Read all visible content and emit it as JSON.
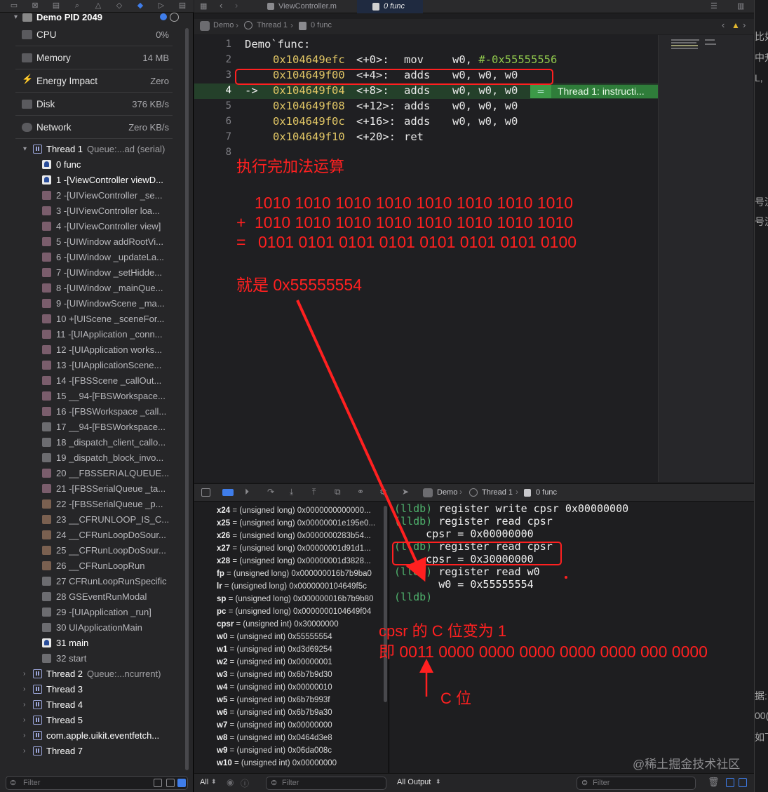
{
  "navigator": {
    "process": "Demo PID 2049",
    "gauges": [
      {
        "label": "CPU",
        "value": "0%"
      },
      {
        "label": "Memory",
        "value": "14 MB"
      },
      {
        "label": "Energy Impact",
        "value": "Zero"
      },
      {
        "label": "Disk",
        "value": "376 KB/s"
      },
      {
        "label": "Network",
        "value": "Zero KB/s"
      }
    ],
    "thread1": {
      "name": "Thread 1",
      "queue": "Queue:...ad (serial)"
    },
    "frames": [
      "0 func",
      "1 -[ViewController viewD...",
      "2 -[UIViewController _se...",
      "3 -[UIViewController loa...",
      "4 -[UIViewController view]",
      "5 -[UIWindow addRootVi...",
      "6 -[UIWindow _updateLa...",
      "7 -[UIWindow _setHidde...",
      "8 -[UIWindow _mainQue...",
      "9 -[UIWindowScene _ma...",
      "10 +[UIScene _sceneFor...",
      "11 -[UIApplication _conn...",
      "12 -[UIApplication works...",
      "13 -[UIApplicationScene...",
      "14 -[FBSScene _callOut...",
      "15 __94-[FBSWorkspace...",
      "16 -[FBSWorkspace _call...",
      "17 __94-[FBSWorkspace...",
      "18 _dispatch_client_callo...",
      "19 _dispatch_block_invo...",
      "20 __FBSSERIALQUEUE...",
      "21 -[FBSSerialQueue _ta...",
      "22 -[FBSSerialQueue _p...",
      "23 __CFRUNLOOP_IS_C...",
      "24 __CFRunLoopDoSour...",
      "25 __CFRunLoopDoSour...",
      "26 __CFRunLoopRun",
      "27 CFRunLoopRunSpecific",
      "28 GSEventRunModal",
      "29 -[UIApplication _run]",
      "30 UIApplicationMain",
      "31 main",
      "32 start"
    ],
    "threads": [
      {
        "name": "Thread 2",
        "queue": "Queue:...ncurrent)"
      },
      {
        "name": "Thread 3",
        "queue": ""
      },
      {
        "name": "Thread 4",
        "queue": ""
      },
      {
        "name": "Thread 5",
        "queue": ""
      },
      {
        "name": "com.apple.uikit.eventfetch...",
        "queue": ""
      },
      {
        "name": "Thread 7",
        "queue": ""
      }
    ],
    "filter_placeholder": "Filter"
  },
  "tabs": {
    "file": "ViewController.m",
    "active": "0 func"
  },
  "jumpbar": {
    "project": "Demo",
    "thread": "Thread 1",
    "frame": "0 func"
  },
  "editor": {
    "lines": [
      {
        "n": "1",
        "addr": "",
        "off": "",
        "op": "",
        "args": "",
        "text": "Demo`func:"
      },
      {
        "n": "2",
        "addr": "0x104649efc",
        "off": "<+0>:",
        "op": "mov",
        "args": "w0, ",
        "imm": "#-0x55555556"
      },
      {
        "n": "3",
        "addr": "0x104649f00",
        "off": "<+4>:",
        "op": "adds",
        "args": "w0, w0, w0"
      },
      {
        "n": "4",
        "addr": "0x104649f04",
        "off": "<+8>:",
        "op": "adds",
        "args": "w0, w0, w0"
      },
      {
        "n": "5",
        "addr": "0x104649f08",
        "off": "<+12>:",
        "op": "adds",
        "args": "w0, w0, w0"
      },
      {
        "n": "6",
        "addr": "0x104649f0c",
        "off": "<+16>:",
        "op": "adds",
        "args": "w0, w0, w0"
      },
      {
        "n": "7",
        "addr": "0x104649f10",
        "off": "<+20>:",
        "op": "ret",
        "args": ""
      },
      {
        "n": "8",
        "addr": "",
        "off": "",
        "op": "",
        "args": ""
      }
    ],
    "arrow": "->",
    "badge": "Thread 1: instructi..."
  },
  "annotations": {
    "title": "执行完加法运算",
    "bin1": "1010 1010 1010 1010 1010 1010 1010 1010",
    "plus": "+",
    "bin2": "1010 1010 1010 1010 1010 1010 1010 1010",
    "eq": "=",
    "bin3": "0101 0101 0101 0101 0101 0101 0101 0100",
    "result": "就是 0x55555554",
    "cpsr_note": "cpsr 的 C 位变为 1",
    "cpsr_bits": "即 0011 0000 0000 0000 0000 0000 000 0000",
    "c_label": "C 位"
  },
  "variables": [
    {
      "name": "x24",
      "val": " = (unsigned long) 0x0000000000000..."
    },
    {
      "name": "x25",
      "val": " = (unsigned long) 0x00000001e195e0..."
    },
    {
      "name": "x26",
      "val": " = (unsigned long) 0x0000000283b54..."
    },
    {
      "name": "x27",
      "val": " = (unsigned long) 0x00000001d91d1..."
    },
    {
      "name": "x28",
      "val": " = (unsigned long) 0x00000001d3828..."
    },
    {
      "name": "fp",
      "val": " = (unsigned long) 0x000000016b7b9ba0"
    },
    {
      "name": "lr",
      "val": " = (unsigned long) 0x0000000104649f5c"
    },
    {
      "name": "sp",
      "val": " = (unsigned long) 0x000000016b7b9b80"
    },
    {
      "name": "pc",
      "val": " = (unsigned long) 0x0000000104649f04"
    },
    {
      "name": "cpsr",
      "val": " = (unsigned int) 0x30000000"
    },
    {
      "name": "w0",
      "val": " = (unsigned int) 0x55555554"
    },
    {
      "name": "w1",
      "val": " = (unsigned int) 0xd3d69254"
    },
    {
      "name": "w2",
      "val": " = (unsigned int) 0x00000001"
    },
    {
      "name": "w3",
      "val": " = (unsigned int) 0x6b7b9d30"
    },
    {
      "name": "w4",
      "val": " = (unsigned int) 0x00000010"
    },
    {
      "name": "w5",
      "val": " = (unsigned int) 0x6b7b993f"
    },
    {
      "name": "w6",
      "val": " = (unsigned int) 0x6b7b9a30"
    },
    {
      "name": "w7",
      "val": " = (unsigned int) 0x00000000"
    },
    {
      "name": "w8",
      "val": " = (unsigned int) 0x0464d3e8"
    },
    {
      "name": "w9",
      "val": " = (unsigned int) 0x06da008c"
    },
    {
      "name": "w10",
      "val": " = (unsigned int) 0x00000000"
    }
  ],
  "console": [
    {
      "prompt": "(lldb)",
      "text": " register write cpsr 0x00000000"
    },
    {
      "prompt": "(lldb)",
      "text": " register read cpsr"
    },
    {
      "prompt": "",
      "text": "     cpsr = 0x00000000"
    },
    {
      "prompt": "(lldb)",
      "text": " register read cpsr"
    },
    {
      "prompt": "",
      "text": "     cpsr = 0x30000000"
    },
    {
      "prompt": "(lldb)",
      "text": " register read w0"
    },
    {
      "prompt": "",
      "text": "       w0 = 0x55555554"
    },
    {
      "prompt": "(lldb)",
      "text": ""
    }
  ],
  "bottombar": {
    "scope": "All",
    "filter": "Filter",
    "output": "All Output",
    "filter2": "Filter"
  },
  "watermark": "@稀土掘金技术社区",
  "right_edge_text": [
    "比如",
    "中升",
    "L,",
    "号流",
    "号流",
    "据:",
    "00(",
    "如下"
  ]
}
